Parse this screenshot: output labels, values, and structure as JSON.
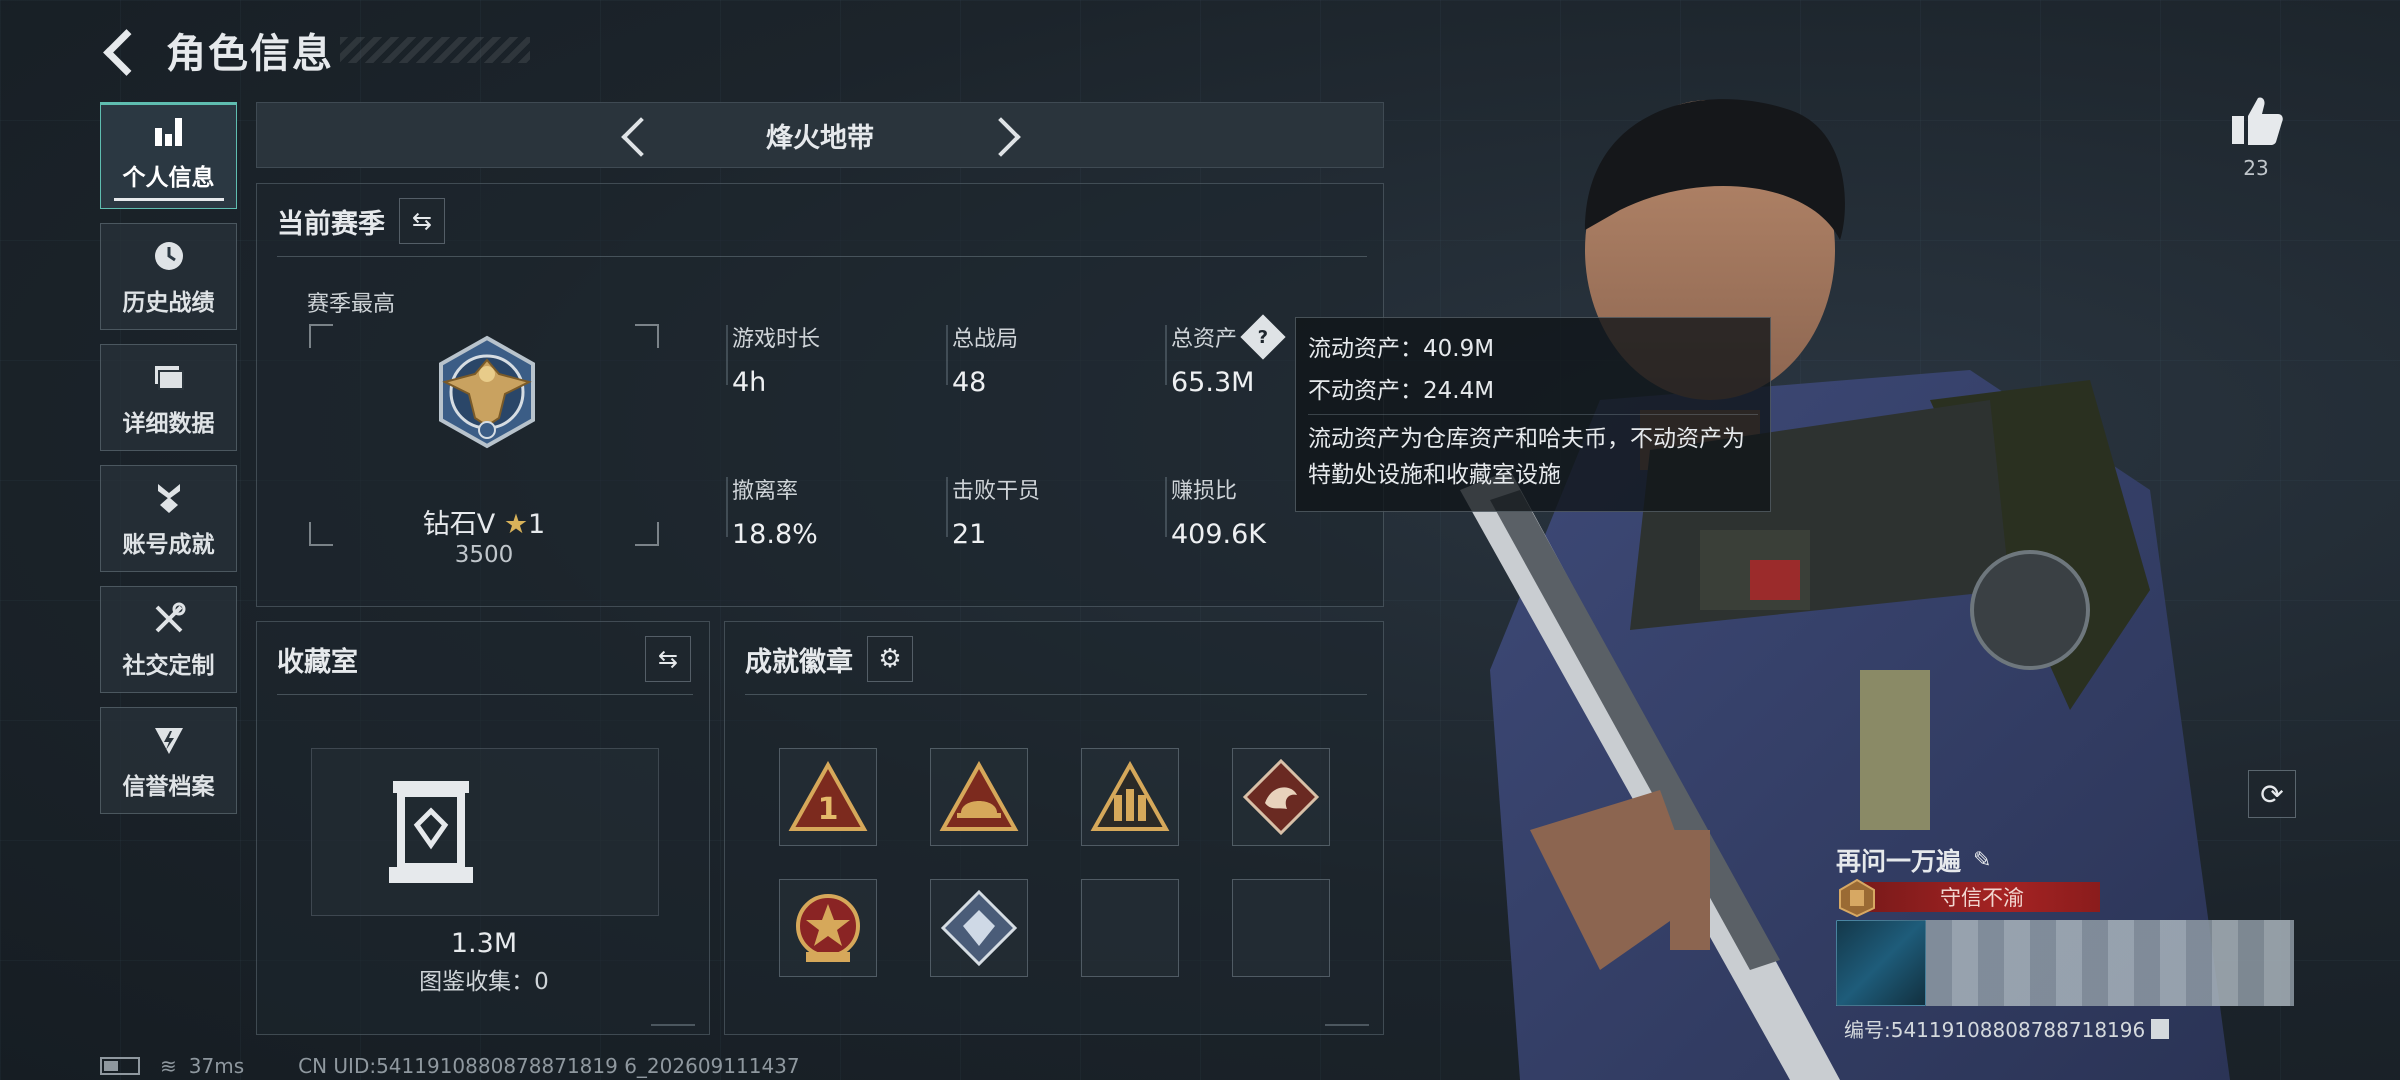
{
  "header": {
    "title": "角色信息"
  },
  "nav": [
    {
      "label": "个人信息",
      "icon": "bar-chart-icon",
      "active": true
    },
    {
      "label": "历史战绩",
      "icon": "history-clock-icon"
    },
    {
      "label": "详细数据",
      "icon": "folder-stack-icon"
    },
    {
      "label": "账号成就",
      "icon": "medal-icon"
    },
    {
      "label": "社交定制",
      "icon": "tools-wrench-icon"
    },
    {
      "label": "信誉档案",
      "icon": "shield-bolt-icon"
    }
  ],
  "mode": {
    "title": "烽火地带"
  },
  "season": {
    "title": "当前赛季",
    "subtitle": "赛季最高",
    "rank_name": "钻石V",
    "rank_stars": "1",
    "rank_score": "3500",
    "stats": [
      {
        "label": "游戏时长",
        "value": "4h"
      },
      {
        "label": "总战局",
        "value": "48"
      },
      {
        "label": "总资产",
        "value": "65.3M"
      },
      {
        "label": "撤离率",
        "value": "18.8%"
      },
      {
        "label": "击败干员",
        "value": "21"
      },
      {
        "label": "赚损比",
        "value": "409.6K"
      }
    ]
  },
  "tooltip": {
    "liquid": "流动资产：40.9M",
    "fixed": "不动资产：24.4M",
    "desc": "流动资产为仓库资产和哈夫币，不动资产为特勤处设施和收藏室设施"
  },
  "collection": {
    "title": "收藏室",
    "value": "1.3M",
    "count": "图鉴收集：0"
  },
  "achievements": {
    "title": "成就徽章",
    "badges": [
      {
        "name": "rank-one-triangle-badge",
        "filled": true
      },
      {
        "name": "helmet-triangle-badge",
        "filled": true
      },
      {
        "name": "soldiers-triangle-badge",
        "filled": true
      },
      {
        "name": "dragon-diamond-badge",
        "filled": true
      },
      {
        "name": "star-round-badge",
        "filled": true
      },
      {
        "name": "crystal-diamond-badge",
        "filled": true
      },
      {
        "name": "empty-badge-slot",
        "filled": false
      },
      {
        "name": "empty-badge-slot",
        "filled": false
      }
    ]
  },
  "status": {
    "ping": "37ms",
    "uid": "CN UID:5411910880878871819 6_202609111437"
  },
  "likes": {
    "count": "23"
  },
  "profile": {
    "name": "再问一万遍",
    "title": "守信不渝",
    "serial": "编号:54119108808788718196"
  },
  "colors": {
    "accent_teal": "#5fbdb0",
    "title_red": "#a52323",
    "panel_bg": "#1e262d"
  }
}
